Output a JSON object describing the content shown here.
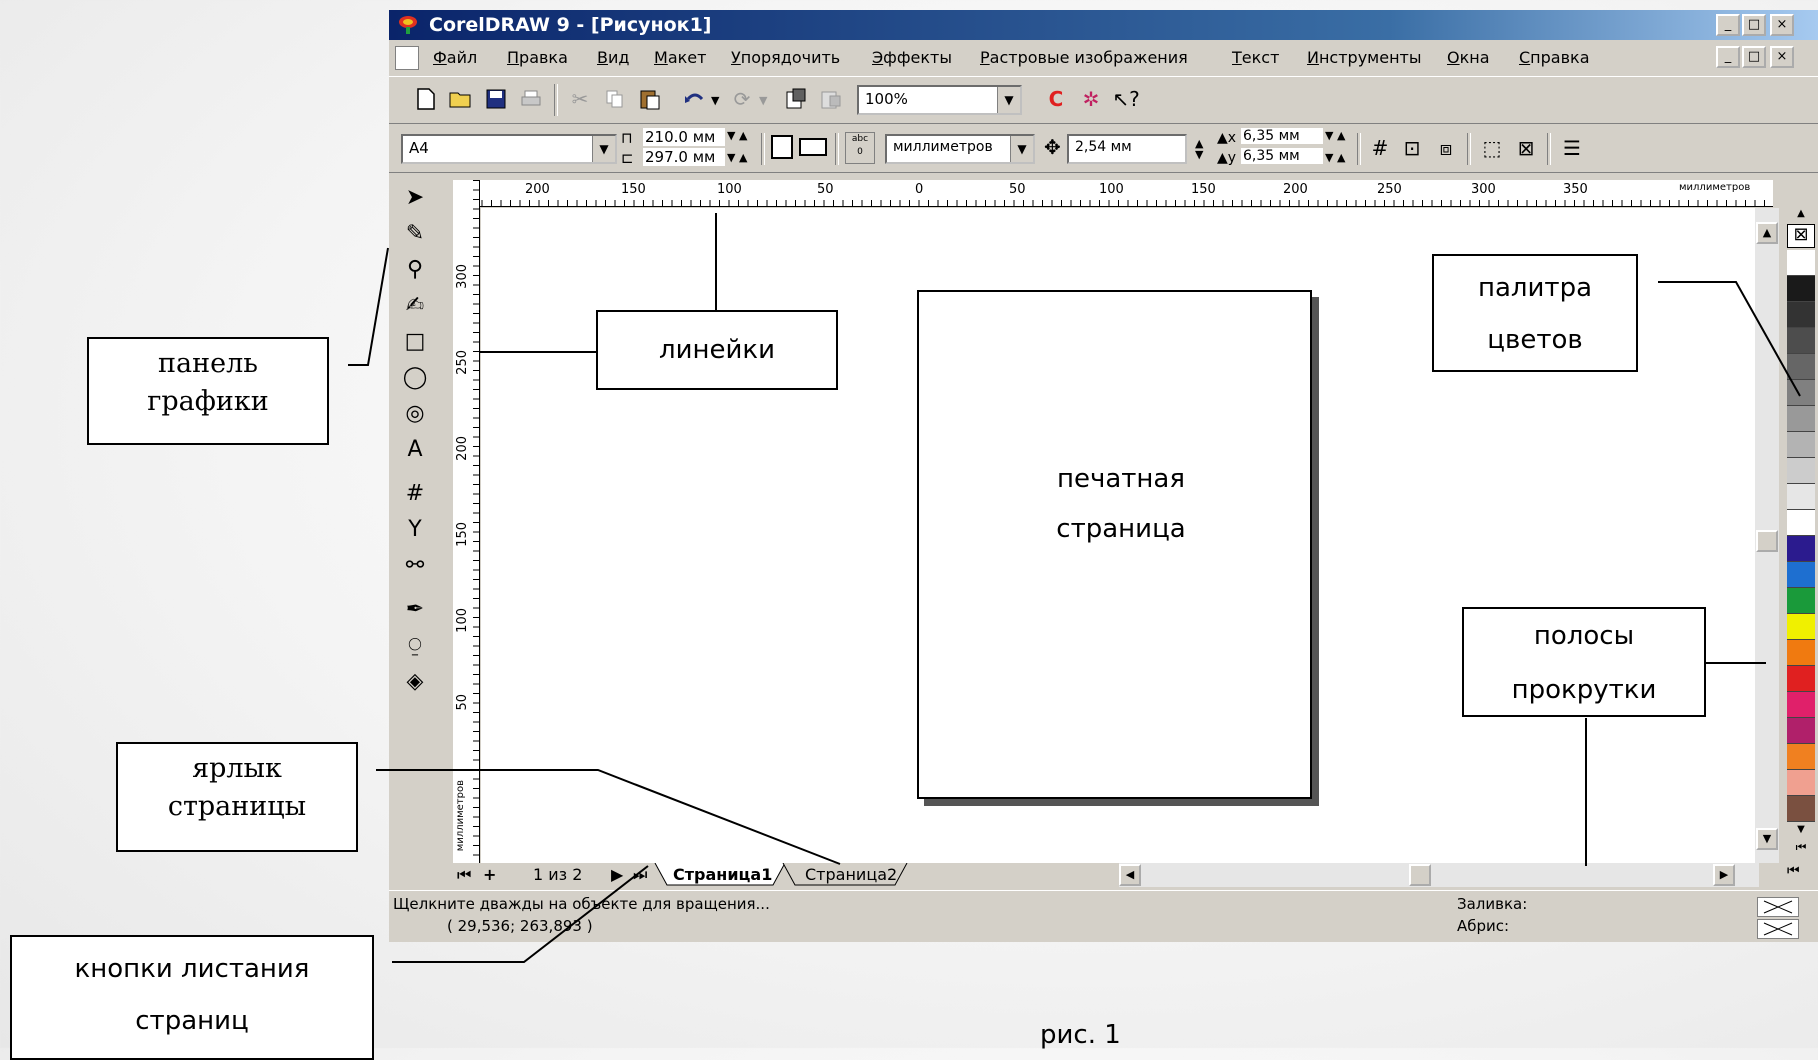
{
  "window": {
    "title": "CorelDRAW 9 - [Рисунок1]",
    "sys_buttons": [
      "_",
      "□",
      "×"
    ]
  },
  "menu": [
    "Файл",
    "Правка",
    "Вид",
    "Макет",
    "Упорядочить",
    "Эффекты",
    "Растровые изображения",
    "Текст",
    "Инструменты",
    "Окна",
    "Справка"
  ],
  "toolbar": {
    "zoom": "100%"
  },
  "property_bar": {
    "paper_size": "A4",
    "width": "210.0 мм",
    "height": "297.0 мм",
    "units": "миллиметров",
    "nudge": "2,54 мм",
    "dup_x": "6,35 мм",
    "dup_y": "6,35 мм"
  },
  "rulers": {
    "h_ticks": [
      "200",
      "150",
      "100",
      "50",
      "0",
      "50",
      "100",
      "150",
      "200",
      "250",
      "300",
      "350"
    ],
    "h_unit": "миллиметров",
    "v_ticks": [
      "300",
      "250",
      "200",
      "150",
      "100",
      "50"
    ],
    "v_unit": "миллиметров"
  },
  "page_nav": {
    "counter": "1 из 2",
    "tabs": [
      "Страница1",
      "Страница2"
    ]
  },
  "status": {
    "hint": "Щелкните дважды на объекте для вращения...",
    "coords": "( 29,536; 263,893 )",
    "fill_label": "Заливка:",
    "outline_label": "Абрис:"
  },
  "palette_colors": [
    "#ffffff",
    "#1a1a1a",
    "#333333",
    "#4d4d4d",
    "#666666",
    "#808080",
    "#999999",
    "#b3b3b3",
    "#cccccc",
    "#e6e6e6",
    "#ffffff",
    "#2b1b8e",
    "#1e6fd0",
    "#1a9a3a",
    "#f0f000",
    "#f07a10",
    "#e02020",
    "#e0206a",
    "#b0206a",
    "#f08020",
    "#f0a090",
    "#7a5040"
  ],
  "callouts": {
    "graphics_panel": [
      "панель",
      "графики"
    ],
    "rulers": "линейки",
    "palette": [
      "палитра",
      "цветов"
    ],
    "print_page": [
      "печатная",
      "страница"
    ],
    "scrollbars": [
      "полосы",
      "прокрутки"
    ],
    "page_tab": [
      "ярлык",
      "страницы"
    ],
    "page_buttons": [
      "кнопки листания",
      "страниц"
    ]
  },
  "caption": "рис. 1"
}
